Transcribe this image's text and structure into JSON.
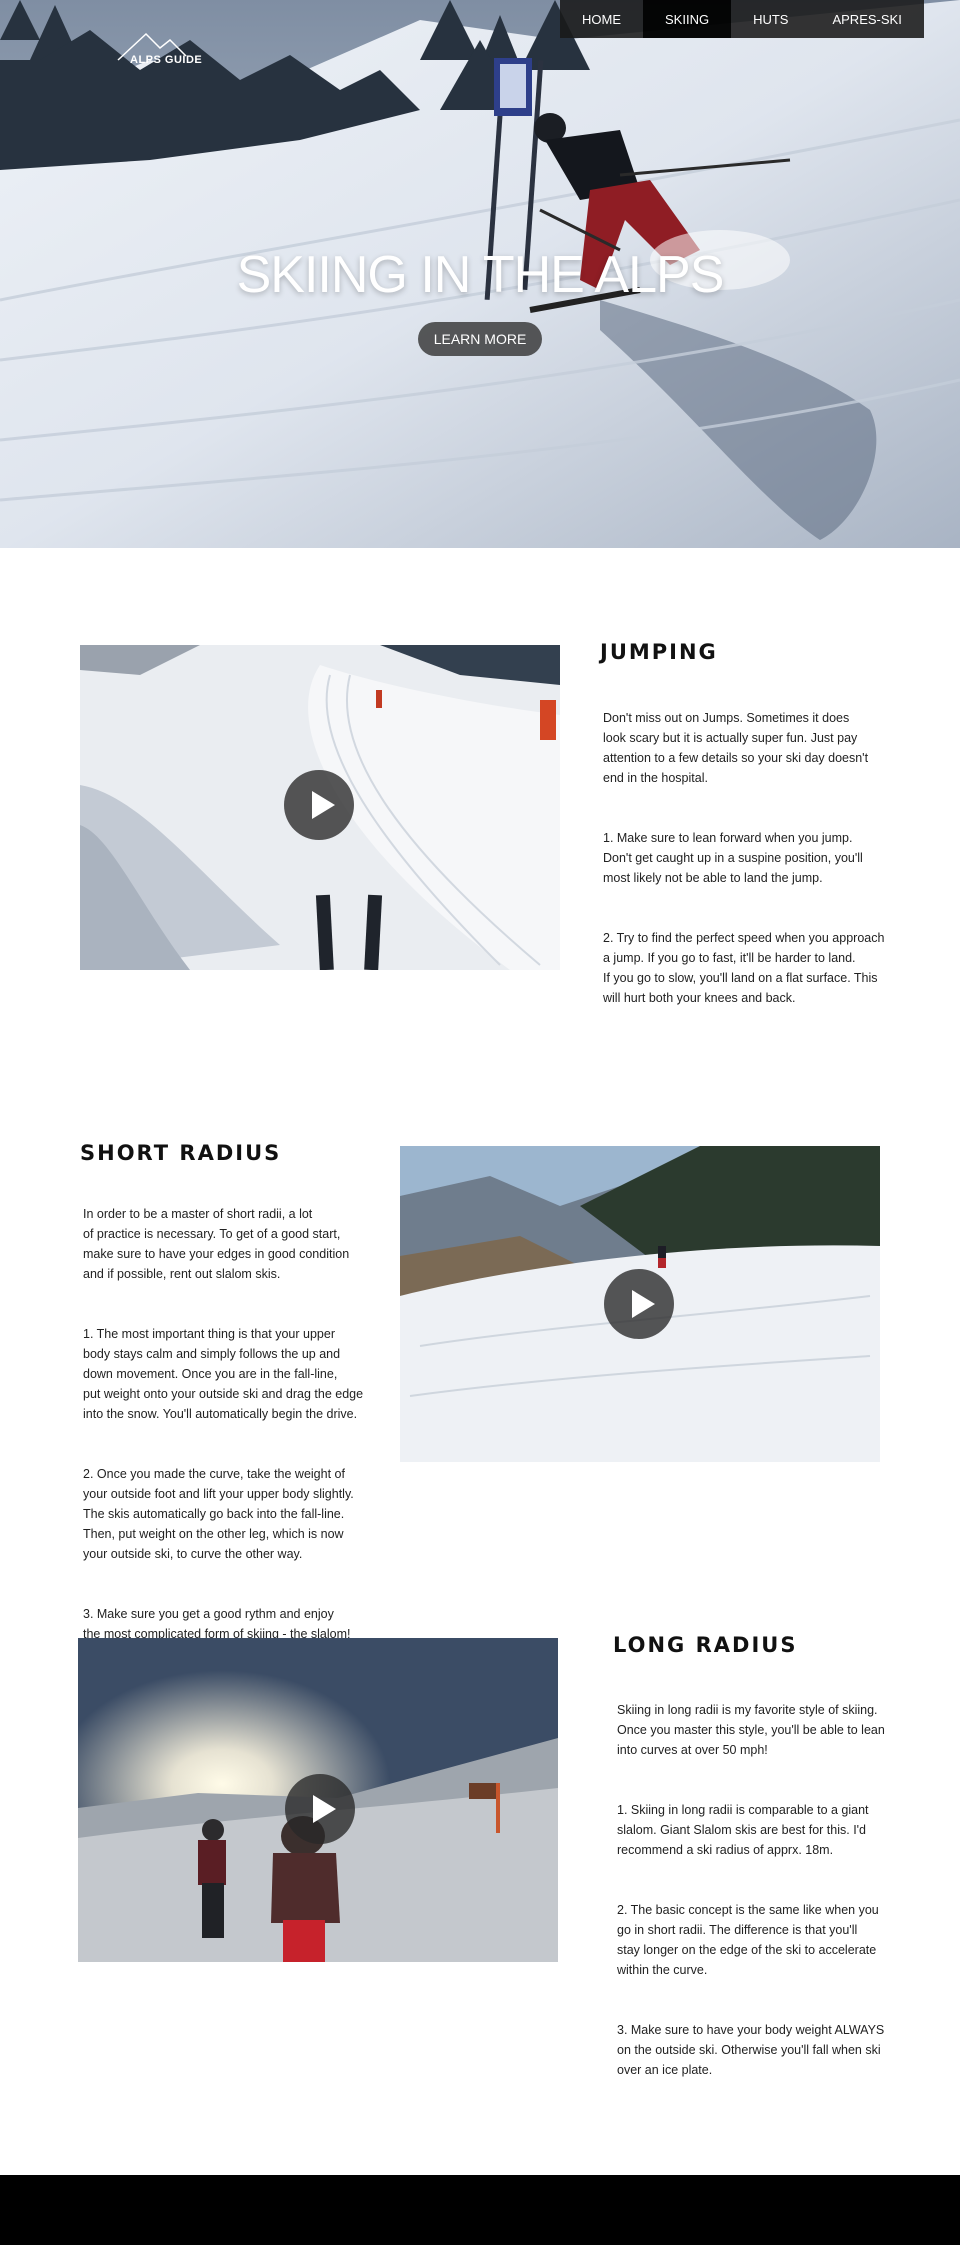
{
  "header": {
    "logo_text": "ALPS GUIDE",
    "nav": [
      {
        "label": "HOME"
      },
      {
        "label": "SKIING"
      },
      {
        "label": "HUTS"
      },
      {
        "label": "APRES-SKI"
      }
    ],
    "active_nav": "SKIING"
  },
  "hero": {
    "title": "SKIING IN THE ALPS",
    "button_label": "LEARN MORE"
  },
  "sections": {
    "jumping": {
      "title": "JUMPING",
      "paragraphs": [
        "Don't miss out on Jumps. Sometimes it does\nlook scary but it is actually super fun. Just pay\nattention to a few details so your ski day doesn't\nend in the hospital.",
        "1. Make sure to lean forward when you jump.\nDon't get caught up in a suspine position, you'll\nmost likely not be able to land the jump.",
        "2. Try to find the perfect speed when you approach\na jump. If you go to fast, it'll be harder to land.\nIf you go to slow, you'll land on a flat surface. This\nwill hurt both your knees and back."
      ]
    },
    "short_radius": {
      "title": "SHORT RADIUS",
      "paragraphs": [
        "In order to be a master of short radii, a lot\nof practice is necessary. To get of a good start,\nmake sure to have your edges in good condition\nand if possible, rent out slalom skis.",
        "1. The most important thing is that your upper\nbody stays calm and simply follows the up and\ndown movement. Once you are in the fall-line,\nput weight onto your outside ski and drag the edge\ninto the snow. You'll automatically begin the drive.",
        "2. Once you made the curve, take the weight of\nyour outside foot and lift your upper body slightly.\nThe skis automatically go back into the fall-line.\nThen, put weight on the other leg, which is now\nyour outside ski, to curve the other way.",
        "3. Make sure you get a good rythm and enjoy\nthe most complicated form of skiing - the slalom!"
      ]
    },
    "long_radius": {
      "title": "LONG RADIUS",
      "paragraphs": [
        "Skiing in long radii is my favorite style of skiing.\nOnce you master this style, you'll be able to lean\ninto curves at over 50 mph!",
        "1. Skiing in long radii is comparable to a giant\nslalom. Giant Slalom skis are best for this. I'd\nrecommend a ski radius of apprx. 18m.",
        "2. The basic concept is the same like when you\ngo in short radii. The difference is that you'll\nstay longer on the edge of the ski to accelerate\nwithin the curve.",
        "3. Make sure to have your body weight ALWAYS\non the outside ski. Otherwise you'll fall when ski\nover an ice plate."
      ]
    }
  },
  "icons": {
    "play": "play-icon",
    "logo": "mountain-logo-icon"
  }
}
